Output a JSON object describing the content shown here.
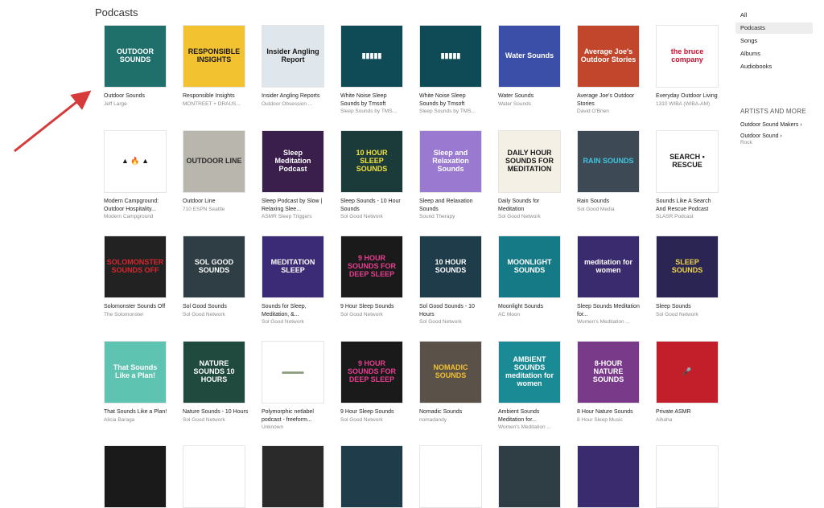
{
  "section_title": "Podcasts",
  "sidebar": {
    "items": [
      {
        "label": "All",
        "selected": false
      },
      {
        "label": "Podcasts",
        "selected": true
      },
      {
        "label": "Songs",
        "selected": false
      },
      {
        "label": "Albums",
        "selected": false
      },
      {
        "label": "Audiobooks",
        "selected": false
      }
    ],
    "artists_heading": "ARTISTS AND MORE",
    "artists": [
      {
        "name": "Outdoor Sound Makers",
        "sub": ""
      },
      {
        "name": "Outdoor Sound",
        "sub": "Rock"
      }
    ]
  },
  "podcasts": [
    {
      "title": "Outdoor Sounds",
      "author": "Jeff Large",
      "art": "OUTDOOR SOUNDS",
      "bg": "#1f6f6b",
      "fg": "#ffffff"
    },
    {
      "title": "Responsible Insights",
      "author": "MONTREET + DRAUS...",
      "art": "RESPONSIBLE INSIGHTS",
      "bg": "#f2c230",
      "fg": "#1a1a1a"
    },
    {
      "title": "Insider Angling Reports",
      "author": "Outdoor Obsession ...",
      "art": "Insider Angling Report",
      "bg": "#dfe6ec",
      "fg": "#1a1a1a"
    },
    {
      "title": "White Noise Sleep Sounds by Tmsoft",
      "author": "Sleep Sounds by TMS...",
      "art": "▮▮▮▮▮",
      "bg": "#0f4b57",
      "fg": "#ffffff"
    },
    {
      "title": "White Noise Sleep Sounds by Tmsoft",
      "author": "Sleep Sounds by TMS...",
      "art": "▮▮▮▮▮",
      "bg": "#0f4b57",
      "fg": "#ffffff"
    },
    {
      "title": "Water Sounds",
      "author": "Water Sounds",
      "art": "Water Sounds",
      "bg": "#3b4fa8",
      "fg": "#ffffff"
    },
    {
      "title": "Average Joe's Outdoor Stories",
      "author": "David O'Brien",
      "art": "Average Joe's Outdoor Stories",
      "bg": "#c2462c",
      "fg": "#ffffff"
    },
    {
      "title": "Everyday Outdoor Living",
      "author": "1310 WIBA (WIBA-AM)",
      "art": "the bruce company",
      "bg": "#ffffff",
      "fg": "#c8102e"
    },
    {
      "title": "Modern Campground: Outdoor Hospitality...",
      "author": "Modern Campground",
      "art": "▲ 🔥 ▲",
      "bg": "#ffffff",
      "fg": "#1a1a1a"
    },
    {
      "title": "Outdoor Line",
      "author": "710 ESPN Seattle",
      "art": "OUTDOOR LINE",
      "bg": "#b9b6ad",
      "fg": "#2b2b2b"
    },
    {
      "title": "Sleep Podcast by Slow | Relaxing Slee...",
      "author": "ASMR Sleep Triggers",
      "art": "Sleep Meditation Podcast",
      "bg": "#3a1f4d",
      "fg": "#ffffff"
    },
    {
      "title": "Sleep Sounds - 10 Hour Sounds",
      "author": "Sol Good Network",
      "art": "10 HOUR SLEEP SOUNDS",
      "bg": "#1b3a3a",
      "fg": "#f3e23a"
    },
    {
      "title": "Sleep and Relaxation Sounds",
      "author": "Sound Therapy",
      "art": "Sleep and Relaxation Sounds",
      "bg": "#9a7ad1",
      "fg": "#ffffff"
    },
    {
      "title": "Daily Sounds for Meditation",
      "author": "Sol Good Network",
      "art": "DAILY HOUR SOUNDS FOR MEDITATION",
      "bg": "#f4f0e6",
      "fg": "#1a1a1a"
    },
    {
      "title": "Rain Sounds",
      "author": "Sol Good Media",
      "art": "RAIN SOUNDS",
      "bg": "#3d4a55",
      "fg": "#3fc6e0"
    },
    {
      "title": "Sounds Like A Search And Rescue Podcast",
      "author": "SLASR Podcast",
      "art": "SEARCH • RESCUE",
      "bg": "#ffffff",
      "fg": "#1a1a1a"
    },
    {
      "title": "Solomonster Sounds Off",
      "author": "The Solomonster",
      "art": "SOLOMONSTER SOUNDS OFF",
      "bg": "#222222",
      "fg": "#d8262e"
    },
    {
      "title": "Sol Good Sounds",
      "author": "Sol Good Network",
      "art": "SOL GOOD SOUNDS",
      "bg": "#2e3e44",
      "fg": "#ffffff"
    },
    {
      "title": "Sounds for Sleep, Meditation, &...",
      "author": "Sol Good Network",
      "art": "MEDITATION SLEEP",
      "bg": "#3b2a75",
      "fg": "#ffffff"
    },
    {
      "title": "9 Hour Sleep Sounds",
      "author": "Sol Good Network",
      "art": "9 HOUR SOUNDS FOR DEEP SLEEP",
      "bg": "#1a1a1a",
      "fg": "#e73f8f"
    },
    {
      "title": "Sol Good Sounds - 10 Hours",
      "author": "Sol Good Network",
      "art": "10 HOUR SOUNDS",
      "bg": "#1f3c4a",
      "fg": "#ffffff"
    },
    {
      "title": "Moonlight Sounds",
      "author": "AC Moon",
      "art": "MOONLIGHT SOUNDS",
      "bg": "#167a86",
      "fg": "#ffffff"
    },
    {
      "title": "Sleep Sounds Meditation for...",
      "author": "Women's Meditation ...",
      "art": "meditation for women",
      "bg": "#3a2b6e",
      "fg": "#ffffff"
    },
    {
      "title": "Sleep Sounds",
      "author": "Sol Good Network",
      "art": "SLEEP SOUNDS",
      "bg": "#2a2552",
      "fg": "#f1d64a"
    },
    {
      "title": "That Sounds Like a Plan!",
      "author": "Alicia Baraga",
      "art": "That Sounds Like a Plan!",
      "bg": "#5fc3b2",
      "fg": "#ffffff"
    },
    {
      "title": "Nature Sounds - 10 Hours",
      "author": "Sol Good Network",
      "art": "NATURE SOUNDS 10 HOURS",
      "bg": "#1f4a3d",
      "fg": "#ffffff"
    },
    {
      "title": "Polymorphic netlabel podcast - freeform...",
      "author": "Unknown",
      "art": "▬▬▬",
      "bg": "#ffffff",
      "fg": "#8a9a7a"
    },
    {
      "title": "9 Hour Sleep Sounds",
      "author": "Sol Good Network",
      "art": "9 HOUR SOUNDS FOR DEEP SLEEP",
      "bg": "#1a1a1a",
      "fg": "#e73f8f"
    },
    {
      "title": "Nomadic Sounds",
      "author": "nomadandy",
      "art": "NOMADIC SOUNDS",
      "bg": "#5a5148",
      "fg": "#f2c230"
    },
    {
      "title": "Ambient Sounds Meditation for...",
      "author": "Women's Meditation ...",
      "art": "AMBIENT SOUNDS meditation for women",
      "bg": "#1a8a94",
      "fg": "#ffffff"
    },
    {
      "title": "8 Hour Nature Sounds",
      "author": "8 Hour Sleep Music",
      "art": "8-HOUR NATURE SOUNDS",
      "bg": "#7a3a8a",
      "fg": "#ffffff"
    },
    {
      "title": "Private ASMR",
      "author": "Aihaha",
      "art": "🎤",
      "bg": "#c21f2b",
      "fg": "#ffffff"
    }
  ],
  "partial_row_colors": [
    "#1a1a1a",
    "#ffffff",
    "#2a2a2a",
    "#1f3c4a",
    "#ffffff",
    "#2e3e44",
    "#3a2b6e",
    "#ffffff"
  ]
}
